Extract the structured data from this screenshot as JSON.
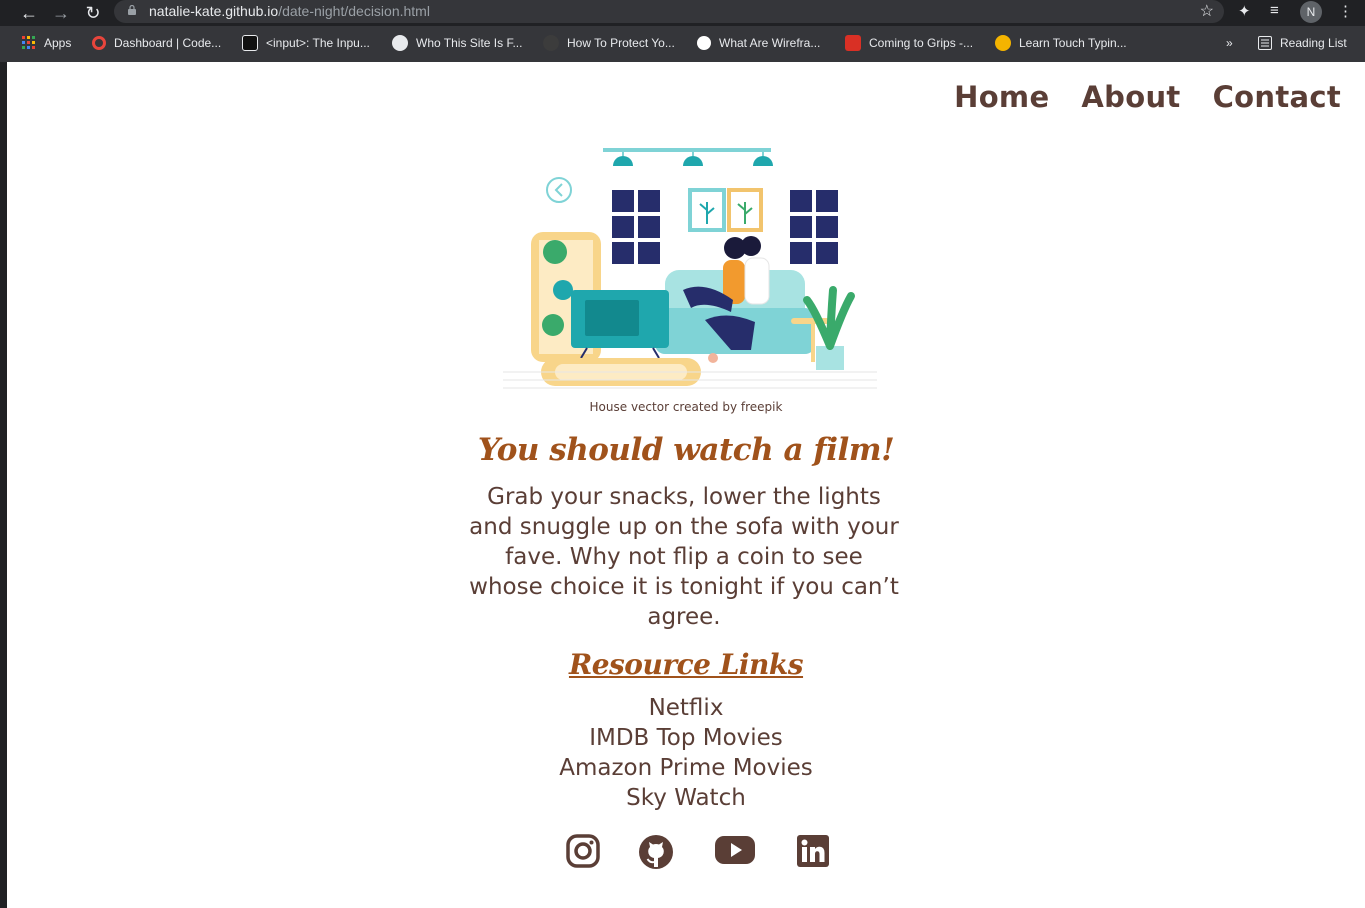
{
  "browser": {
    "url_host": "natalie-kate.github.io",
    "url_path": "/date-night/decision.html",
    "profile_initial": "N",
    "bookmarks": [
      {
        "label": "Apps",
        "color": "#e8453c"
      },
      {
        "label": "Dashboard | Code...",
        "color": "#e8453c"
      },
      {
        "label": "<input>: The Inpu...",
        "color": "#111111"
      },
      {
        "label": "Who This Site Is F...",
        "color": "#e8eaed"
      },
      {
        "label": "How To Protect Yo...",
        "color": "#222222"
      },
      {
        "label": "What Are Wirefra...",
        "color": "#ffffff"
      },
      {
        "label": "Coming to Grips -...",
        "color": "#d93025"
      },
      {
        "label": "Learn Touch Typin...",
        "color": "#f4b400"
      }
    ],
    "reading_list": "Reading List",
    "overflow": "»"
  },
  "nav": {
    "home": "Home",
    "about": "About",
    "contact": "Contact"
  },
  "hero": {
    "credit": "House vector created by freepik"
  },
  "main": {
    "headline": "You should watch a film!",
    "body": "Grab your snacks, lower the lights and snuggle up on the sofa with your fave. Why not flip a coin to see whose choice it is tonight if you can’t agree."
  },
  "resources": {
    "title": "Resource Links",
    "links": [
      "Netflix",
      "IMDB Top Movies",
      "Amazon Prime Movies",
      "Sky Watch"
    ]
  },
  "social": [
    "instagram-icon",
    "github-icon",
    "youtube-icon",
    "linkedin-icon"
  ],
  "colors": {
    "text_brown": "#5a3e36",
    "accent_orange": "#a0521b"
  }
}
